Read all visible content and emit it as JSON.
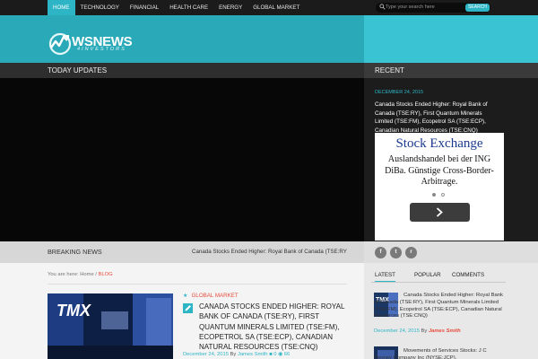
{
  "nav": {
    "items": [
      "HOME",
      "TECHNOLOGY",
      "FINANCIAL",
      "HEALTH CARE",
      "ENERGY",
      "GLOBAL MARKET"
    ],
    "active": "HOME"
  },
  "search": {
    "placeholder": "Type your search here",
    "button": "SEARCH"
  },
  "logo": {
    "name": "WSNEWS",
    "sub": "4INVESTORS"
  },
  "today": {
    "title": "TODAY UPDATES"
  },
  "recent": {
    "title": "RECENT",
    "date": "DECEMBER 24, 2015",
    "post_title": "Canada Stocks Ended Higher: Royal Bank of Canada (TSE:RY), First Quantum Minerals Limited (TSE:FM), Ecopetrol SA (TSE:ECP), Canadian Natural Resources (TSE:CNQ)"
  },
  "ad": {
    "headline": "Stock Exchange",
    "body": "Auslandshandel bei der ING DiBa. Günstige Cross-Border-Arbitrage.",
    "active_dot": 0
  },
  "breaking": {
    "label": "BREAKING NEWS",
    "ticker": "Canada Stocks Ended Higher: Royal Bank of Canada (TSE:RY), First Quantum Minerals Limited (TSE:FM)"
  },
  "social": {
    "facebook": "f",
    "twitter": "t",
    "rss": "r"
  },
  "breadcrumb": {
    "prefix": "You are here:",
    "home": "Home",
    "sep": "/",
    "current": "BLOG"
  },
  "post": {
    "category": "GLOBAL MARKET",
    "title": "CANADA STOCKS ENDED HIGHER: ROYAL BANK OF CANADA (TSE:RY), FIRST QUANTUM MINERALS LIMITED (TSE:FM), ECOPETROL SA (TSE:ECP), CANADIAN NATURAL RESOURCES (TSE:CNQ)",
    "date": "December 24, 2015",
    "by": "By",
    "author": "James Smith",
    "comments": "0",
    "views": "66",
    "thumb_text": "TMX"
  },
  "sidebar": {
    "tabs": [
      "LATEST",
      "POPULAR",
      "COMMENTS"
    ],
    "active_tab": "LATEST",
    "items": [
      {
        "title": "Canada Stocks Ended Higher: Royal Bank of Canada (TSE:RY), First Quantum Minerals Limited (TSE:FM), Ecopetrol SA (TSE:ECP), Canadian Natural Resources (TSE:CNQ)",
        "date": "December 24, 2015",
        "by": "By",
        "author": "James Smith"
      },
      {
        "title": "Movements of Services Stocks: J C Penney Company Inc (NYSE:JCP),",
        "date": "",
        "by": "",
        "author": ""
      }
    ]
  },
  "colors": {
    "accent": "#2db5c6",
    "red": "#e74c3c",
    "header": "#2aa9b8"
  }
}
